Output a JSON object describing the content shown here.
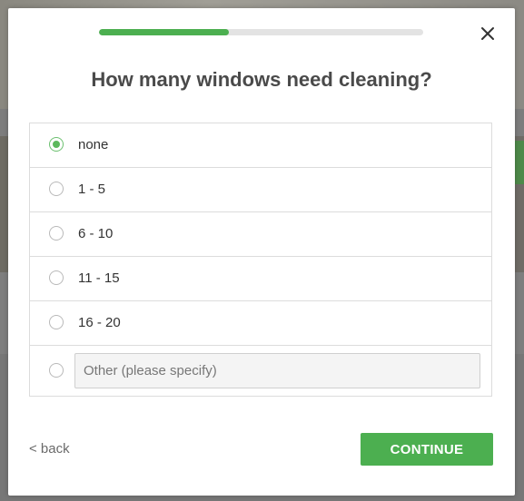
{
  "modal": {
    "progress": 0.4,
    "question": "How many windows need cleaning?",
    "options": [
      {
        "label": "none",
        "selected": true
      },
      {
        "label": "1 - 5",
        "selected": false
      },
      {
        "label": "6 - 10",
        "selected": false
      },
      {
        "label": "11 - 15",
        "selected": false
      },
      {
        "label": "16 - 20",
        "selected": false
      }
    ],
    "other": {
      "placeholder": "Other (please specify)",
      "value": "",
      "selected": false
    },
    "back_label": "< back",
    "continue_label": "CONTINUE",
    "close_icon": "close-icon"
  },
  "colors": {
    "accent": "#4caf50",
    "progress_track": "#e3e3e3",
    "heading": "#4a4a4a"
  }
}
